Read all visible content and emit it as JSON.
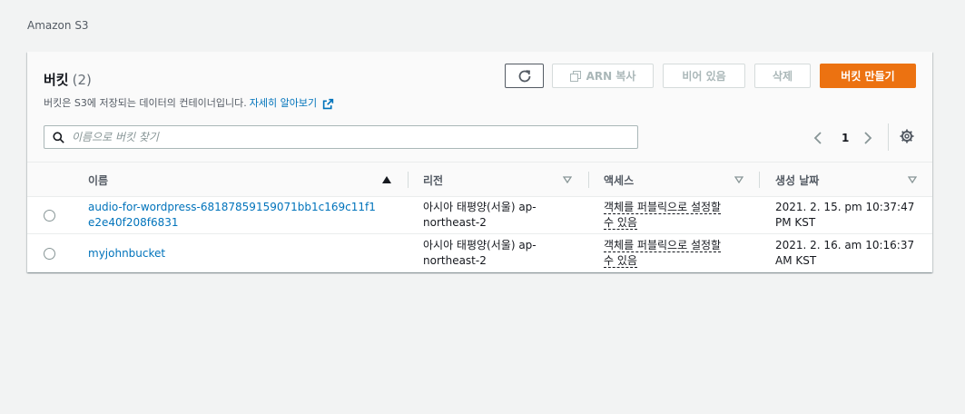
{
  "breadcrumb": "Amazon S3",
  "panel": {
    "title": "버킷",
    "count": "(2)",
    "description": "버킷은 S3에 저장되는 데이터의 컨테이너입니다.",
    "learn_more": "자세히 알아보기"
  },
  "toolbar": {
    "arn_copy_label": "ARN 복사",
    "empty_label": "비어 있음",
    "delete_label": "삭제",
    "create_label": "버킷 만들기"
  },
  "search": {
    "placeholder": "이름으로 버킷 찾기"
  },
  "pagination": {
    "current_page": "1"
  },
  "table": {
    "columns": [
      {
        "label": "이름"
      },
      {
        "label": "리전"
      },
      {
        "label": "액세스"
      },
      {
        "label": "생성 날짜"
      }
    ],
    "rows": [
      {
        "name": "audio-for-wordpress-68187859159071bb1c169c11f1e2e40f208f6831",
        "region": "아시아 태평양(서울) ap-northeast-2",
        "access_line1": "객체를 퍼블릭으로 설정할",
        "access_line2": "수 있음",
        "created_line1": "2021. 2. 15. pm 10:37:47",
        "created_line2": "PM KST"
      },
      {
        "name": "myjohnbucket",
        "region": "아시아 태평양(서울) ap-northeast-2",
        "access_line1": "객체를 퍼블릭으로 설정할",
        "access_line2": "수 있음",
        "created_line1": "2021. 2. 16. am 10:16:37",
        "created_line2": "AM KST"
      }
    ]
  },
  "colors": {
    "primary_orange": "#ec7211",
    "link_blue": "#0073bb",
    "background": "#f2f3f3"
  }
}
